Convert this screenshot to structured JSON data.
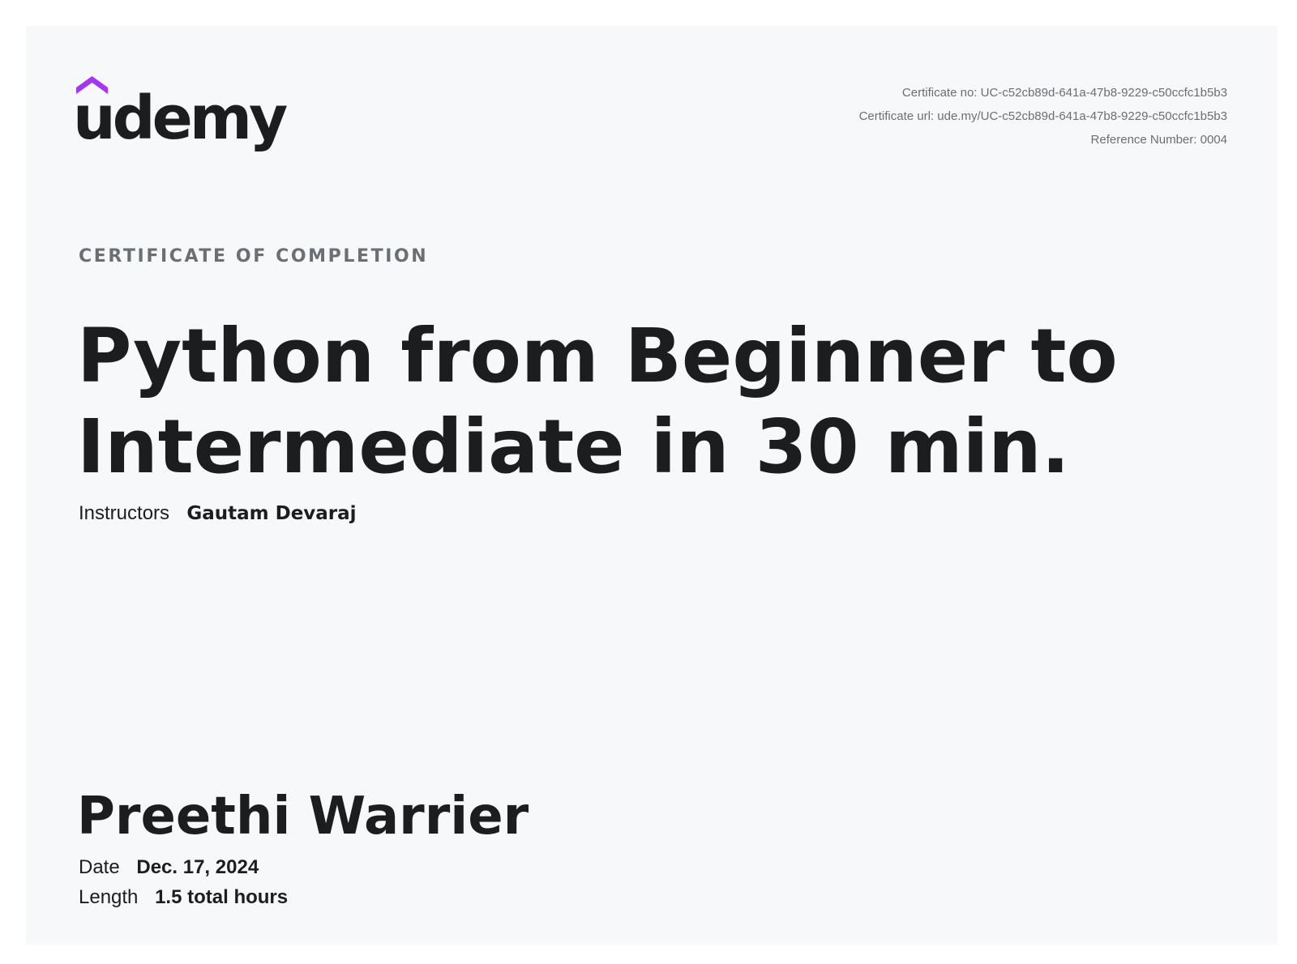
{
  "brand": {
    "logo_text": "udemy",
    "logo_accent_color": "#a435f0",
    "logo_text_color": "#1c1d1f"
  },
  "certificate": {
    "number_label": "Certificate no:",
    "number": "UC-c52cb89d-641a-47b8-9229-c50ccfc1b5b3",
    "url_label": "Certificate url:",
    "url": "ude.my/UC-c52cb89d-641a-47b8-9229-c50ccfc1b5b3",
    "reference_label": "Reference Number:",
    "reference": "0004",
    "eyebrow": "CERTIFICATE OF COMPLETION"
  },
  "course": {
    "title": "Python from Beginner to Intermediate in 30 min.",
    "instructors_label": "Instructors",
    "instructors": "Gautam Devaraj"
  },
  "recipient": {
    "name": "Preethi Warrier"
  },
  "details": {
    "date_label": "Date",
    "date": "Dec. 17, 2024",
    "length_label": "Length",
    "length": "1.5 total hours"
  }
}
